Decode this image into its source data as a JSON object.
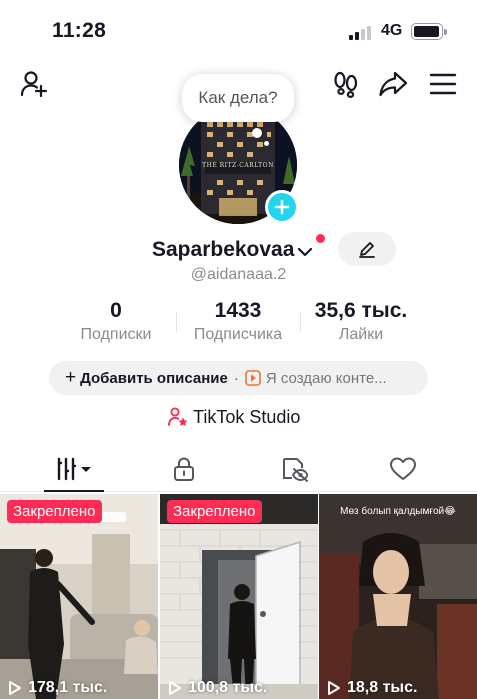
{
  "status_bar": {
    "time": "11:28",
    "network": "4G"
  },
  "bubble": {
    "text": "Как дела?"
  },
  "profile": {
    "name": "Saparbekovaa",
    "handle": "@aidanaaa.2",
    "avatar_sign_text": "THE RITZ-CARLTON"
  },
  "stats": [
    {
      "value": "0",
      "label": "Подписки"
    },
    {
      "value": "1433",
      "label": "Подписчика"
    },
    {
      "value": "35,6 тыс.",
      "label": "Лайки"
    }
  ],
  "bio": {
    "add_label": "Добавить описание",
    "separator": "·",
    "creator_text": "Я создаю конте..."
  },
  "studio": {
    "label": "TikTok Studio"
  },
  "tabs": [
    "videos",
    "private",
    "reposts",
    "liked"
  ],
  "videos": [
    {
      "pinned_label": "Закреплено",
      "views": "178,1 тыс."
    },
    {
      "pinned_label": "Закреплено",
      "views": "100,8 тыс."
    },
    {
      "caption": "Мөз болып қалдымғой😂",
      "views": "18,8 тыс."
    }
  ],
  "colors": {
    "accent_red": "#fe2c55",
    "accent_cyan": "#20d5ec",
    "text_primary": "#161823",
    "text_secondary": "#8a8b91",
    "chip_bg": "#f1f1f2"
  }
}
